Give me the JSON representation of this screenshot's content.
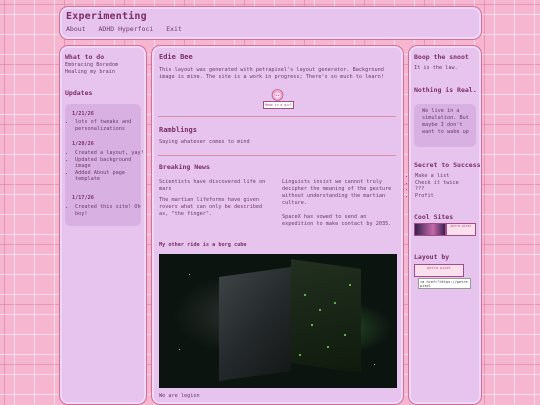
{
  "header": {
    "title": "Experimenting",
    "nav": [
      "About",
      "ADHD Hyperfoci",
      "Exit"
    ]
  },
  "left": {
    "what_heading": "What to do",
    "what_lines": [
      "Embracing Boredom",
      "Healing my brain"
    ],
    "updates_heading": "Updates",
    "updates": [
      {
        "date": "1/21/26",
        "items": [
          "lots of tweaks and personalizations"
        ]
      },
      {
        "date": "1/20/26",
        "items": [
          "Created a layout, yay!",
          "Updated background image",
          "Added About page template"
        ]
      },
      {
        "date": "1/17/26",
        "items": [
          "Created this site! Oh boy!"
        ]
      }
    ]
  },
  "main": {
    "name": "Edie Bee",
    "intro": "This layout was generated with petrapixel's layout generator. Background image is mine. The site is a work in progress; There's so much to learn!",
    "badge": "Made in a girl",
    "ramblings_heading": "Ramblings",
    "ramblings_text": "Saying whatever comes to mind",
    "news_heading": "Breaking News",
    "news_left": [
      "Scientists have discovered life on mars",
      "The martian lifeforms have given rovers what can only be described as, \"the finger\"."
    ],
    "news_right": [
      "Linguists insist we cannot truly decipher the meaning of the gesture without understanding the martian culture.",
      "SpaceX has vowed to send an expedition to make contact by 2035."
    ],
    "photo_heading": "My other ride is a borg cube",
    "photo_caption": "We are legion"
  },
  "right": {
    "boop_heading": "Boop the snoot",
    "boop_text": "It is the law.",
    "real_heading": "Nothing is Real.",
    "real_quote": "We live in a simulation. But maybe I don't want to wake up",
    "secret_heading": "Secret to Success",
    "secret_items": [
      "Make a list",
      "Check it twice",
      "???",
      "Profit"
    ],
    "cool_heading": "Cool Sites",
    "cool_badge_2": "petra pixel",
    "layout_heading": "Layout by",
    "layout_badge": "petra pixel",
    "layout_code": "<a href=\"https://petrapixel"
  },
  "colors": {
    "panel": "#e6c4ee",
    "border": "#cf6fa0",
    "accent": "#7b2e66",
    "background": "#f7b6cf"
  }
}
